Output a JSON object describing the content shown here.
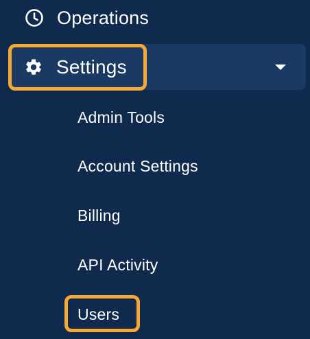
{
  "nav": {
    "operations": {
      "label": "Operations",
      "icon": "clock-icon"
    },
    "settings": {
      "label": "Settings",
      "icon": "gear-icon",
      "expanded": true,
      "chevron": "caret-down-icon",
      "sub_items": [
        {
          "label": "Admin Tools"
        },
        {
          "label": "Account Settings"
        },
        {
          "label": "Billing"
        },
        {
          "label": "API Activity"
        },
        {
          "label": "Users"
        }
      ]
    }
  },
  "colors": {
    "background": "#0f2a4d",
    "active_row": "#1a3a63",
    "highlight": "#f7a934",
    "text": "#ffffff"
  }
}
